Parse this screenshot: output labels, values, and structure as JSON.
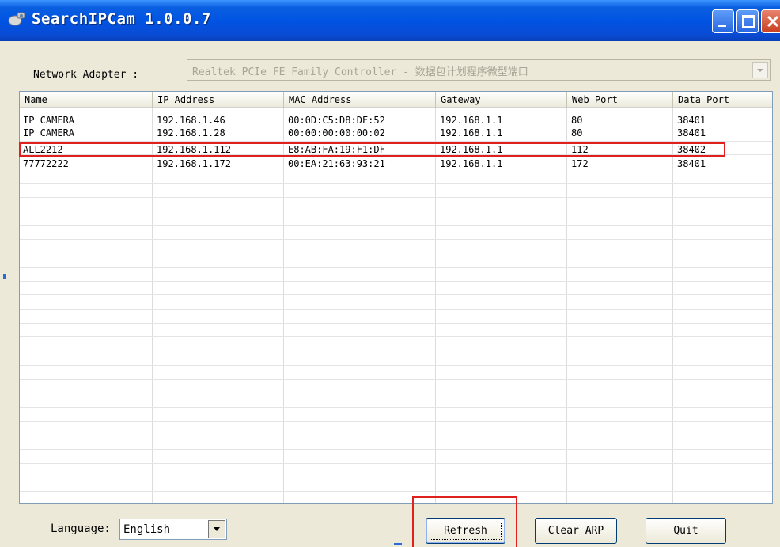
{
  "window": {
    "title": "SearchIPCam 1.0.0.7"
  },
  "adapter": {
    "label": "Network Adapter :",
    "value": "Realtek PCIe FE Family Controller - 数据包计划程序微型端口"
  },
  "table": {
    "columns": [
      "Name",
      "IP Address",
      "MAC Address",
      "Gateway",
      "Web Port",
      "Data Port"
    ],
    "rows": [
      [
        "IP CAMERA",
        "192.168.1.46",
        "00:0D:C5:D8:DF:52",
        "192.168.1.1",
        "80",
        "38401"
      ],
      [
        "IP CAMERA",
        "192.168.1.28",
        "00:00:00:00:00:02",
        "192.168.1.1",
        "80",
        "38401"
      ],
      [
        "ALL2212",
        "192.168.1.112",
        "E8:AB:FA:19:F1:DF",
        "192.168.1.1",
        "112",
        "38402"
      ],
      [
        "77772222",
        "192.168.1.172",
        "00:EA:21:63:93:21",
        "192.168.1.1",
        "172",
        "38401"
      ]
    ]
  },
  "language": {
    "label": "Language:",
    "value": "English"
  },
  "buttons": {
    "refresh": "Refresh",
    "clear_arp": "Clear ARP",
    "quit": "Quit"
  },
  "colors": {
    "titlebar": "#0054e3",
    "highlight": "#e0201c",
    "face": "#ece9d8"
  }
}
